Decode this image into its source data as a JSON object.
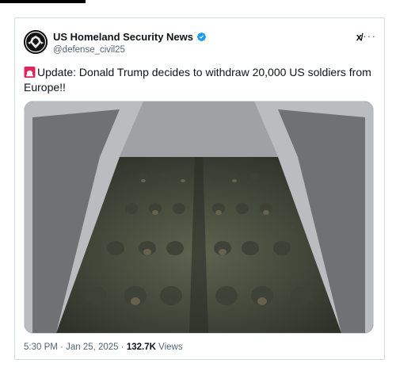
{
  "account": {
    "display_name": "US Homeland Security News",
    "handle": "@defense_civil25",
    "verified": true
  },
  "actions": {
    "grok_label": "x̸",
    "more_label": "···"
  },
  "tweet": {
    "text": "Update: Donald Trump decides to withdraw 20,000 US soldiers from Europe!!",
    "leading_icon": "siren-icon"
  },
  "media": {
    "icon": "photo-soldiers-aircraft"
  },
  "meta": {
    "time": "5:30 PM",
    "separator": "·",
    "date": "Jan 25, 2025",
    "views_count": "132.7K",
    "views_label": "Views"
  },
  "colors": {
    "accent": "#1d9bf0",
    "text": "#0f1419",
    "muted": "#536471",
    "border": "#cfd9de"
  }
}
